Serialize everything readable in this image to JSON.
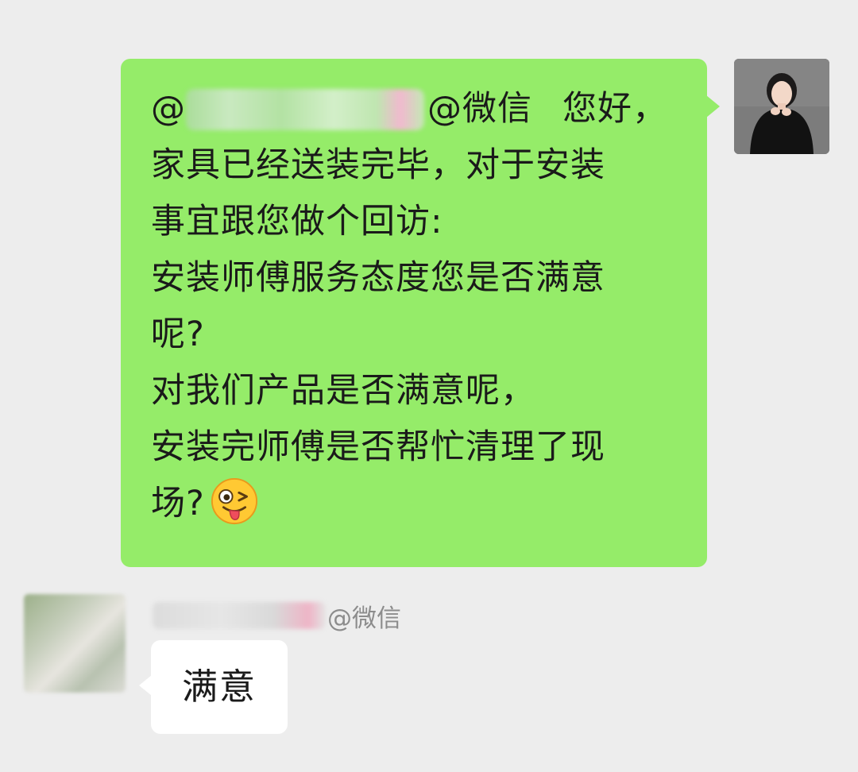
{
  "outgoing_message": {
    "mention_prefix": "@",
    "mention_suffix": "@微信",
    "greeting": "您好，",
    "lines": [
      "家具已经送装完毕，对于安装",
      "事宜跟您做个回访:",
      "安装师傅服务态度您是否满意",
      "呢?",
      "对我们产品是否满意呢，",
      "安装完师傅是否帮忙清理了现"
    ],
    "last_line": "场?",
    "emoji": "winking-tongue-emoji",
    "bubble_color": "#95ec69"
  },
  "incoming_message": {
    "sender_suffix": "@微信",
    "text": "满意",
    "bubble_color": "#ffffff"
  },
  "background_color": "#ededed"
}
